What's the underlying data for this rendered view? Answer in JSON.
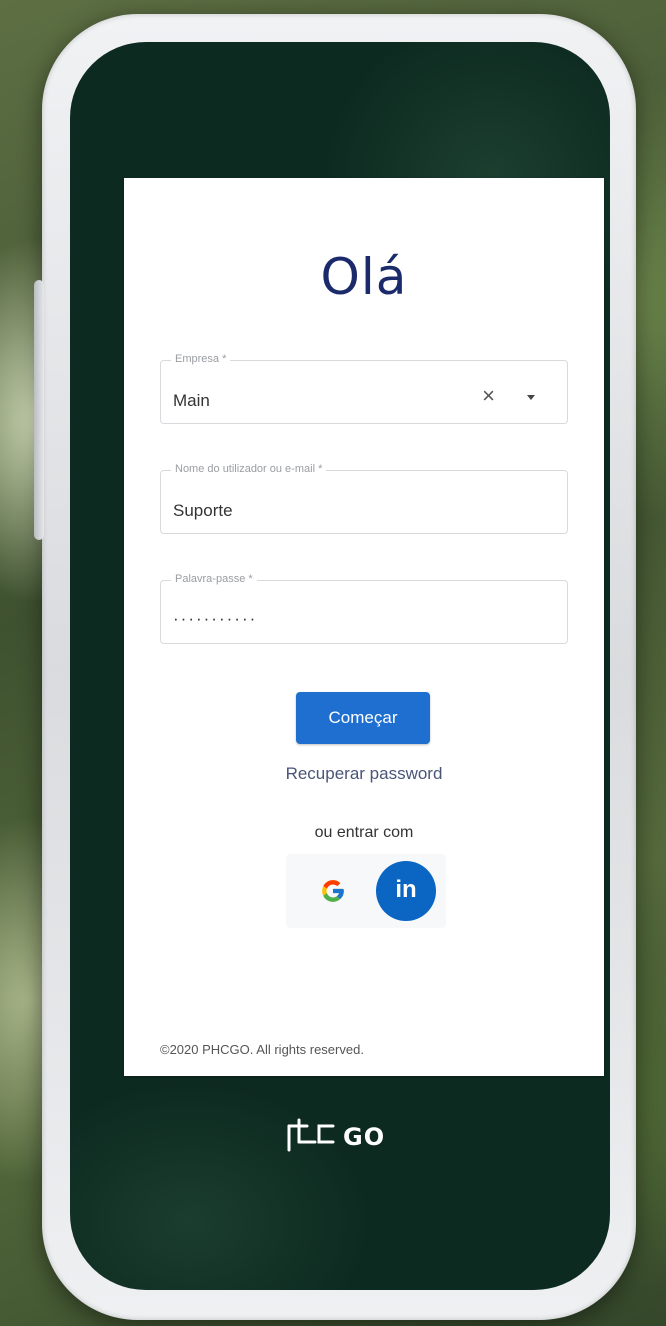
{
  "login": {
    "greeting": "Olá",
    "company_field": {
      "label": "Empresa *",
      "value": "Main"
    },
    "user_field": {
      "label": "Nome do utilizador ou e-mail *",
      "value": "Suporte"
    },
    "password_field": {
      "label": "Palavra-passe *",
      "value": "···········"
    },
    "start_button": "Começar",
    "recover_link": "Recuperar password",
    "or_text": "ou entrar com",
    "social": {
      "google_icon": "google-icon",
      "linkedin_label": "in"
    },
    "copyright": "©2020 PHCGO. All rights reserved."
  },
  "brand": {
    "name": "phc GO",
    "logo_icon": "phcgo-logo-icon"
  },
  "colors": {
    "primary_button": "#1f6fd1",
    "greeting": "#1b2a6b",
    "linkedin": "#0a66c2",
    "screen_bg": "#0d2a20"
  }
}
